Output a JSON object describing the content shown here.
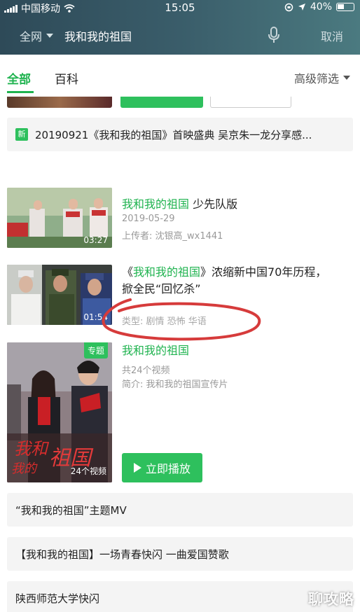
{
  "status": {
    "carrier": "中国移动",
    "time": "15:05",
    "battery": "40%"
  },
  "search": {
    "scope": "全网",
    "query": "我和我的祖国",
    "cancel": "取消"
  },
  "tabs": [
    {
      "label": "全部"
    },
    {
      "label": "百科"
    }
  ],
  "filter": {
    "label": "高级筛选"
  },
  "news": {
    "badge": "新",
    "text": "20190921《我和我的祖国》首映盛典 吴京朱一龙分享感..."
  },
  "results": [
    {
      "title_hl": "我和我的祖国",
      "title_rest": " 少先队版",
      "duration": "03:27",
      "date": "2019-05-29",
      "uploader": "上传者: 沈银高_wx1441"
    },
    {
      "title_pre": "《",
      "title_hl": "我和我的祖国",
      "title_rest": "》浓缩新中国70年历程，",
      "title_line2": "掀全民“回忆杀”",
      "duration": "01:54",
      "type": "类型: 剧情 恐怖 华语"
    }
  ],
  "topic": {
    "badge": "专题",
    "title": "我和我的祖国",
    "count": "共24个视频",
    "intro": "简介: 我和我的祖国宣传片",
    "video_count": "24个视频",
    "play_label": "立即播放"
  },
  "related": [
    "“我和我的祖国”主题MV",
    "【我和我的祖国】一场青春快闪 一曲爱国赞歌",
    "陕西师范大学快闪"
  ],
  "watermark": "聊攻略",
  "colors": {
    "accent": "#1fb34f",
    "header": "#2e4a58",
    "annotation": "#d63b3b"
  }
}
